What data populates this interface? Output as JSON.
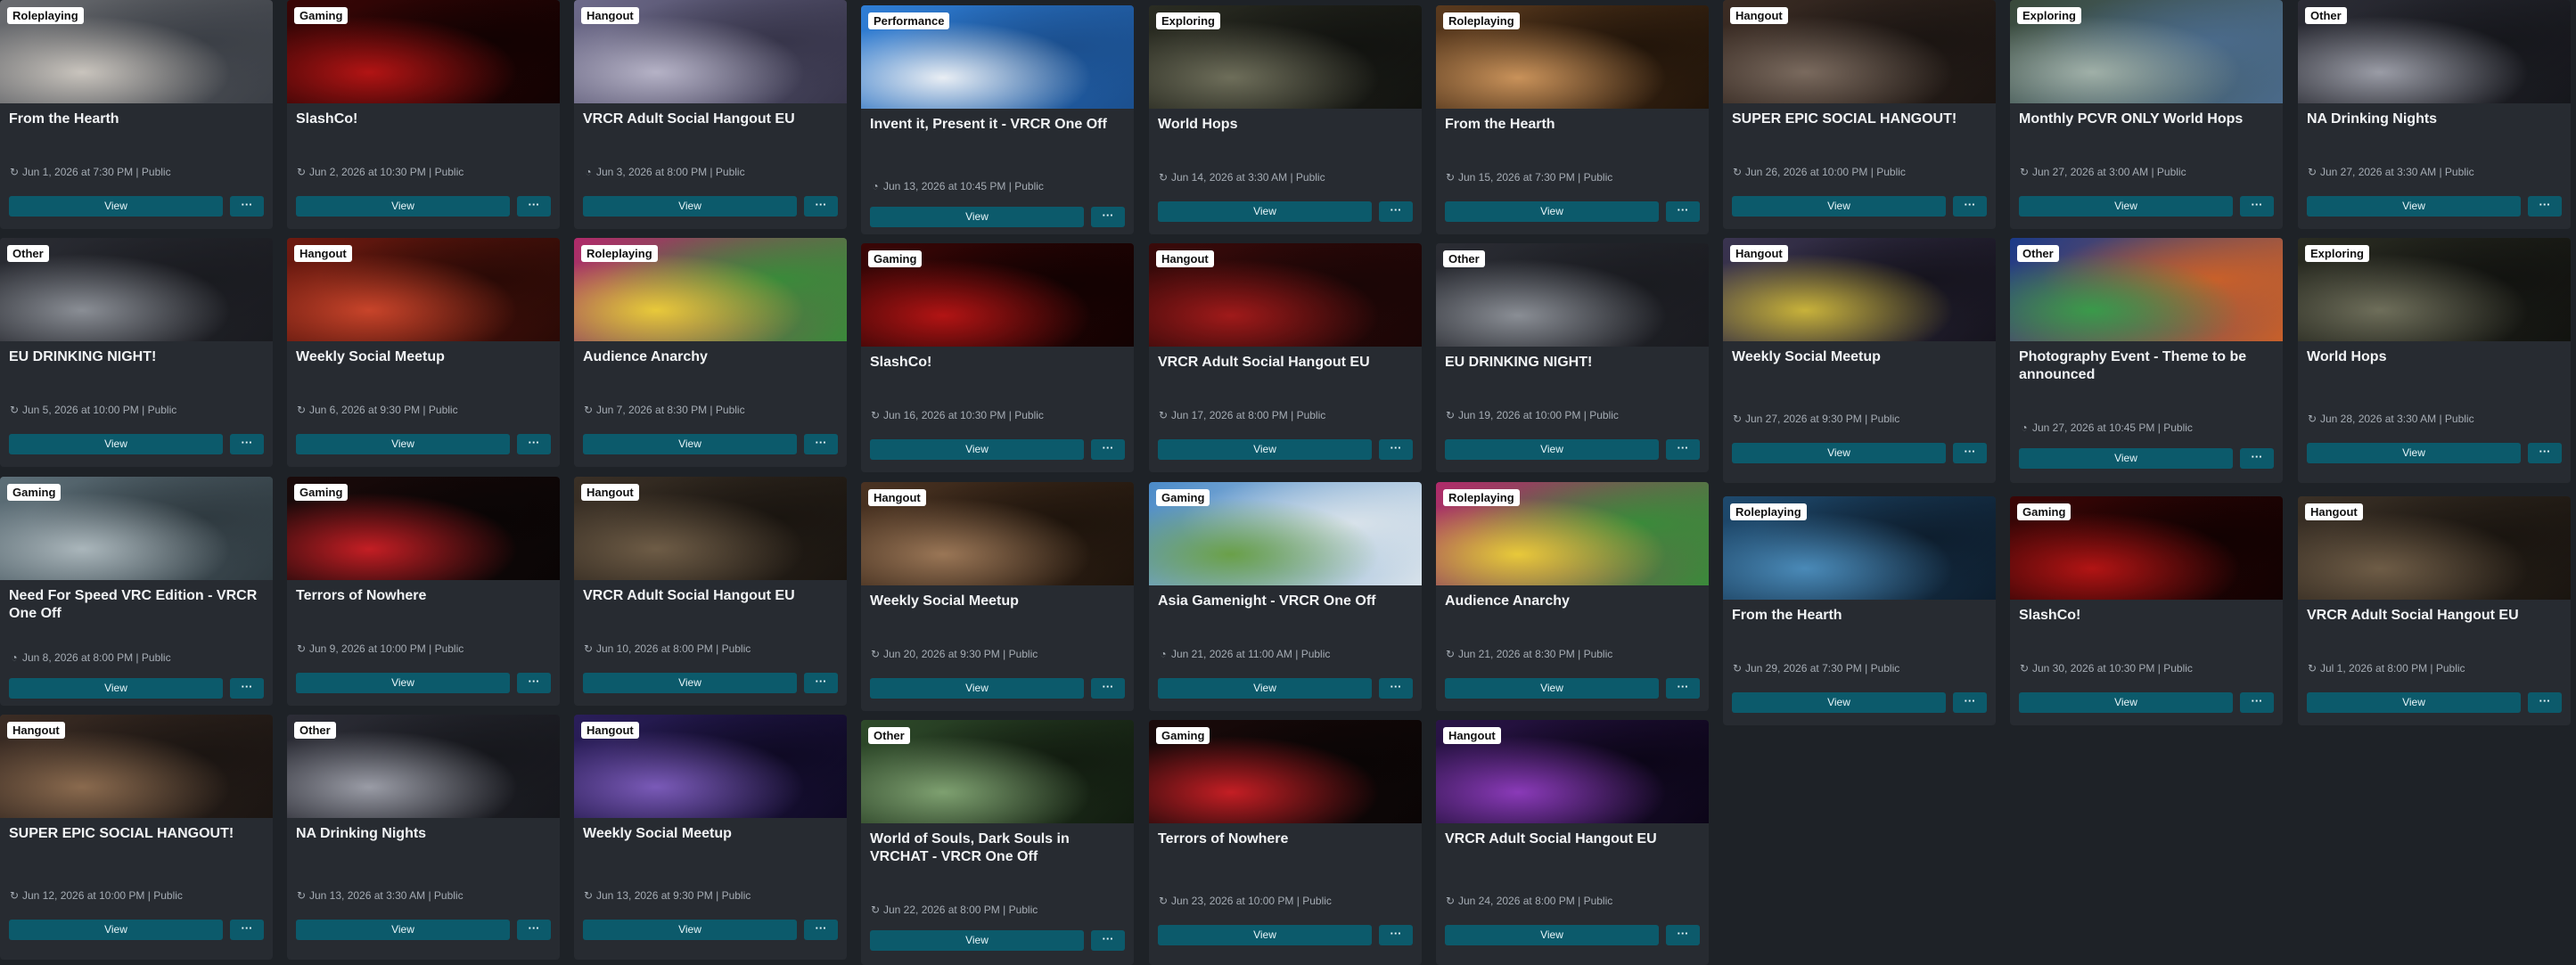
{
  "events": [
    {
      "tag": "Roleplaying",
      "title": "From the Hearth",
      "date": "Jun 1, 2026 at 7:30 PM",
      "visibility": "Public",
      "recurrence": "recurring-icon",
      "view_label": "View",
      "more_label": "···",
      "colors": [
        "#6a6c70",
        "#c9c4bd",
        "#3b3f46"
      ]
    },
    {
      "tag": "Other",
      "title": "EU DRINKING NIGHT!",
      "date": "Jun 5, 2026 at 10:00 PM",
      "visibility": "Public",
      "recurrence": "recurring-icon",
      "view_label": "View",
      "more_label": "···",
      "colors": [
        "#2a2c33",
        "#8a8e95",
        "#1a1b20"
      ]
    },
    {
      "tag": "Gaming",
      "title": "Need For Speed VRC Edition - VRCR One Off",
      "date": "Jun 8, 2026 at 8:00 PM",
      "visibility": "Public",
      "recurrence": "single-icon",
      "view_label": "View",
      "more_label": "···",
      "colors": [
        "#5d6f78",
        "#aab6bb",
        "#2f3a40"
      ]
    },
    {
      "tag": "Hangout",
      "title": "SUPER EPIC SOCIAL HANGOUT!",
      "date": "Jun 12, 2026 at 10:00 PM",
      "visibility": "Public",
      "recurrence": "recurring-icon",
      "view_label": "View",
      "more_label": "···",
      "colors": [
        "#3b2c24",
        "#8a6a4e",
        "#1b1512"
      ]
    },
    {
      "tag": "Gaming",
      "title": "SlashCo!",
      "date": "Jun 2, 2026 at 10:30 PM",
      "visibility": "Public",
      "recurrence": "recurring-icon",
      "view_label": "View",
      "more_label": "···",
      "colors": [
        "#3a0606",
        "#b21414",
        "#120202"
      ]
    },
    {
      "tag": "Hangout",
      "title": "Weekly Social Meetup",
      "date": "Jun 6, 2026 at 9:30 PM",
      "visibility": "Public",
      "recurrence": "recurring-icon",
      "view_label": "View",
      "more_label": "···",
      "colors": [
        "#6e1a10",
        "#c8442a",
        "#2a0a06"
      ]
    },
    {
      "tag": "Gaming",
      "title": "Terrors of Nowhere",
      "date": "Jun 9, 2026 at 10:00 PM",
      "visibility": "Public",
      "recurrence": "recurring-icon",
      "view_label": "View",
      "more_label": "···",
      "colors": [
        "#1a0a0a",
        "#c41e24",
        "#0a0505"
      ]
    },
    {
      "tag": "Other",
      "title": "NA Drinking Nights",
      "date": "Jun 13, 2026 at 3:30 AM",
      "visibility": "Public",
      "recurrence": "recurring-icon",
      "view_label": "View",
      "more_label": "···",
      "colors": [
        "#2c2d36",
        "#9a9ca6",
        "#16171c"
      ]
    },
    {
      "tag": "Hangout",
      "title": "VRCR Adult Social Hangout EU",
      "date": "Jun 3, 2026 at 8:00 PM",
      "visibility": "Public",
      "recurrence": "single-icon",
      "view_label": "View",
      "more_label": "···",
      "colors": [
        "#6d6a8a",
        "#b5b2c6",
        "#37354a"
      ]
    },
    {
      "tag": "Roleplaying",
      "title": "Audience Anarchy",
      "date": "Jun 7, 2026 at 8:30 PM",
      "visibility": "Public",
      "recurrence": "recurring-icon",
      "view_label": "View",
      "more_label": "···",
      "colors": [
        "#b02a6a",
        "#e8c93a",
        "#3a8a3a"
      ]
    },
    {
      "tag": "Hangout",
      "title": "VRCR Adult Social Hangout EU",
      "date": "Jun 10, 2026 at 8:00 PM",
      "visibility": "Public",
      "recurrence": "recurring-icon",
      "view_label": "View",
      "more_label": "···",
      "colors": [
        "#3a3026",
        "#6e5c46",
        "#1a1510"
      ]
    },
    {
      "tag": "Hangout",
      "title": "Weekly Social Meetup",
      "date": "Jun 13, 2026 at 9:30 PM",
      "visibility": "Public",
      "recurrence": "recurring-icon",
      "view_label": "View",
      "more_label": "···",
      "colors": [
        "#2a1e5a",
        "#7a5ab8",
        "#0f0a24"
      ]
    },
    {
      "tag": "Performance",
      "title": "Invent it, Present it - VRCR One Off",
      "date": "Jun 13, 2026 at 10:45 PM",
      "visibility": "Public",
      "recurrence": "single-icon",
      "view_label": "View",
      "more_label": "···",
      "colors": [
        "#2f7ed6",
        "#e9eef4",
        "#1b4f8e"
      ]
    },
    {
      "tag": "Gaming",
      "title": "SlashCo!",
      "date": "Jun 16, 2026 at 10:30 PM",
      "visibility": "Public",
      "recurrence": "recurring-icon",
      "view_label": "View",
      "more_label": "···",
      "colors": [
        "#3a0606",
        "#b21414",
        "#120202"
      ]
    },
    {
      "tag": "Hangout",
      "title": "Weekly Social Meetup",
      "date": "Jun 20, 2026 at 9:30 PM",
      "visibility": "Public",
      "recurrence": "recurring-icon",
      "view_label": "View",
      "more_label": "···",
      "colors": [
        "#4a3322",
        "#9a7656",
        "#1e140c"
      ]
    },
    {
      "tag": "Other",
      "title": "World of Souls, Dark Souls in VRCHAT - VRCR One Off",
      "date": "Jun 22, 2026 at 8:00 PM",
      "visibility": "Public",
      "recurrence": "recurring-icon",
      "view_label": "View",
      "more_label": "···",
      "colors": [
        "#2e4a2a",
        "#7ea070",
        "#121c10"
      ]
    },
    {
      "tag": "Exploring",
      "title": "World Hops",
      "date": "Jun 14, 2026 at 3:30 AM",
      "visibility": "Public",
      "recurrence": "recurring-icon",
      "view_label": "View",
      "more_label": "···",
      "colors": [
        "#2a2c22",
        "#6e6e5a",
        "#121310"
      ]
    },
    {
      "tag": "Hangout",
      "title": "VRCR Adult Social Hangout EU",
      "date": "Jun 17, 2026 at 8:00 PM",
      "visibility": "Public",
      "recurrence": "recurring-icon",
      "view_label": "View",
      "more_label": "···",
      "colors": [
        "#3a0a0a",
        "#a01a1a",
        "#1a0606"
      ]
    },
    {
      "tag": "Gaming",
      "title": "Asia Gamenight - VRCR One Off",
      "date": "Jun 21, 2026 at 11:00 AM",
      "visibility": "Public",
      "recurrence": "single-icon",
      "view_label": "View",
      "more_label": "···",
      "colors": [
        "#4a8ac8",
        "#6aa048",
        "#d8e2ea"
      ]
    },
    {
      "tag": "Gaming",
      "title": "Terrors of Nowhere",
      "date": "Jun 23, 2026 at 10:00 PM",
      "visibility": "Public",
      "recurrence": "recurring-icon",
      "view_label": "View",
      "more_label": "···",
      "colors": [
        "#1a0a0a",
        "#c41e24",
        "#0a0505"
      ]
    },
    {
      "tag": "Roleplaying",
      "title": "From the Hearth",
      "date": "Jun 15, 2026 at 7:30 PM",
      "visibility": "Public",
      "recurrence": "recurring-icon",
      "view_label": "View",
      "more_label": "···",
      "colors": [
        "#5a3a1e",
        "#c9925a",
        "#22150a"
      ]
    },
    {
      "tag": "Other",
      "title": "EU DRINKING NIGHT!",
      "date": "Jun 19, 2026 at 10:00 PM",
      "visibility": "Public",
      "recurrence": "recurring-icon",
      "view_label": "View",
      "more_label": "···",
      "colors": [
        "#2a2c33",
        "#8a8e95",
        "#1a1b20"
      ]
    },
    {
      "tag": "Roleplaying",
      "title": "Audience Anarchy",
      "date": "Jun 21, 2026 at 8:30 PM",
      "visibility": "Public",
      "recurrence": "recurring-icon",
      "view_label": "View",
      "more_label": "···",
      "colors": [
        "#b02a6a",
        "#e8c93a",
        "#3a8a3a"
      ]
    },
    {
      "tag": "Hangout",
      "title": "VRCR Adult Social Hangout EU",
      "date": "Jun 24, 2026 at 8:00 PM",
      "visibility": "Public",
      "recurrence": "recurring-icon",
      "view_label": "View",
      "more_label": "···",
      "colors": [
        "#2a1448",
        "#8a3ab8",
        "#0c0618"
      ]
    },
    {
      "tag": "Hangout",
      "title": "SUPER EPIC SOCIAL HANGOUT!",
      "date": "Jun 26, 2026 at 10:00 PM",
      "visibility": "Public",
      "recurrence": "recurring-icon",
      "view_label": "View",
      "more_label": "···",
      "colors": [
        "#3b2c24",
        "#7a6a5e",
        "#1b1512"
      ]
    },
    {
      "tag": "Hangout",
      "title": "Weekly Social Meetup",
      "date": "Jun 27, 2026 at 9:30 PM",
      "visibility": "Public",
      "recurrence": "recurring-icon",
      "view_label": "View",
      "more_label": "···",
      "colors": [
        "#3a3450",
        "#c8b23a",
        "#16141e"
      ]
    },
    {
      "tag": "Roleplaying",
      "title": "From the Hearth",
      "date": "Jun 29, 2026 at 7:30 PM",
      "visibility": "Public",
      "recurrence": "recurring-icon",
      "view_label": "View",
      "more_label": "···",
      "colors": [
        "#1e4a6e",
        "#4a8ab8",
        "#0e1e2e"
      ]
    },
    {
      "tag": "Exploring",
      "title": "Monthly PCVR ONLY World Hops",
      "date": "Jun 27, 2026 at 3:00 AM",
      "visibility": "Public",
      "recurrence": "recurring-icon",
      "view_label": "View",
      "more_label": "···",
      "colors": [
        "#3a4a3a",
        "#a0b0a8",
        "#4a6a8a"
      ]
    },
    {
      "tag": "Other",
      "title": "Photography Event - Theme to be announced",
      "date": "Jun 27, 2026 at 10:45 PM",
      "visibility": "Public",
      "recurrence": "single-icon",
      "view_label": "View",
      "more_label": "···",
      "colors": [
        "#1a3a8a",
        "#3a9a4a",
        "#c8602a"
      ]
    },
    {
      "tag": "Gaming",
      "title": "SlashCo!",
      "date": "Jun 30, 2026 at 10:30 PM",
      "visibility": "Public",
      "recurrence": "recurring-icon",
      "view_label": "View",
      "more_label": "···",
      "colors": [
        "#3a0606",
        "#b21414",
        "#120202"
      ]
    },
    {
      "tag": "Other",
      "title": "NA Drinking Nights",
      "date": "Jun 27, 2026 at 3:30 AM",
      "visibility": "Public",
      "recurrence": "recurring-icon",
      "view_label": "View",
      "more_label": "···",
      "colors": [
        "#2c2d36",
        "#9a9ca6",
        "#16171c"
      ]
    },
    {
      "tag": "Exploring",
      "title": "World Hops",
      "date": "Jun 28, 2026 at 3:30 AM",
      "visibility": "Public",
      "recurrence": "recurring-icon",
      "view_label": "View",
      "more_label": "···",
      "colors": [
        "#2a2c22",
        "#6e6e5a",
        "#121310"
      ]
    },
    {
      "tag": "Hangout",
      "title": "VRCR Adult Social Hangout EU",
      "date": "Jul 1, 2026 at 8:00 PM",
      "visibility": "Public",
      "recurrence": "recurring-icon",
      "view_label": "View",
      "more_label": "···",
      "colors": [
        "#3a3026",
        "#6e5c46",
        "#1a1510"
      ]
    }
  ],
  "theme": {
    "background": "#1e2227",
    "card": "#272b31",
    "button": "#0c5a6b",
    "text": "#f1f3f5",
    "muted": "#a5acb4"
  }
}
